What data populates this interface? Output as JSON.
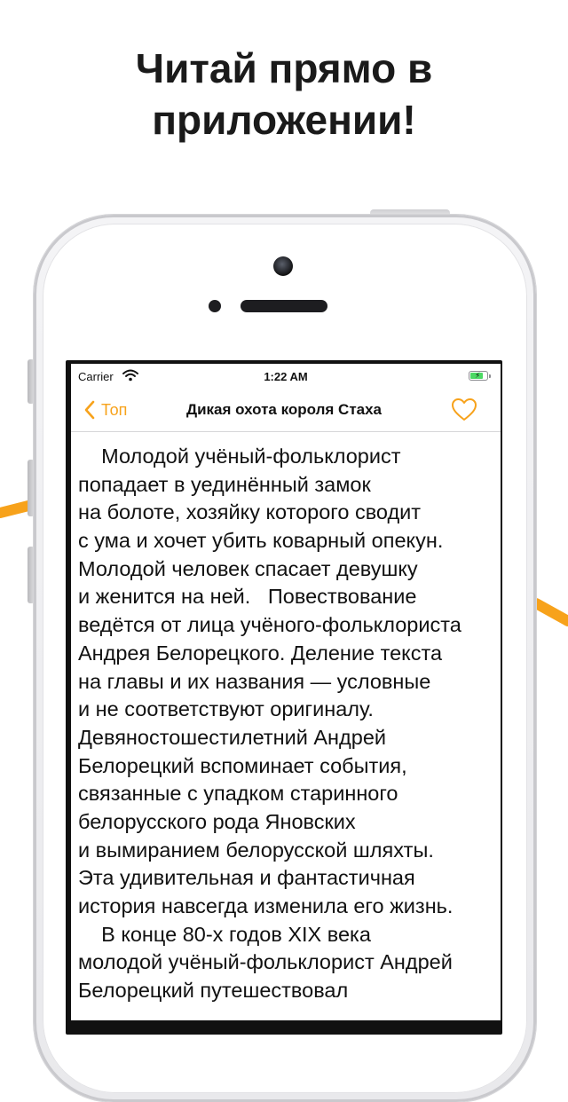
{
  "headline": {
    "line1": "Читай прямо в",
    "line2": "приложении!"
  },
  "colors": {
    "accent": "#f7a21b",
    "text": "#1a1a1a",
    "battery": "#4cd964"
  },
  "status_bar": {
    "carrier": "Carrier",
    "time": "1:22 AM",
    "battery_level": 0.8,
    "charging": true
  },
  "nav": {
    "back_label": "Топ",
    "back_icon": "chevron-left-icon",
    "title": "Дикая охота короля Стаха",
    "favorite_icon": "heart-outline-icon"
  },
  "reader": {
    "lines": [
      "    Молодой учёный-фольклорист",
      "попадает в уединённый замок",
      "на болоте, хозяйку которого сводит",
      "с ума и хочет убить коварный опекун.",
      "Молодой человек спасает девушку",
      "и женится на ней.   Повествование",
      "ведётся от лица учёного-фольклориста",
      "Андрея Белорецкого. Деление текста",
      "на главы и их названия — условные",
      "и не соответствуют оригиналу.",
      "Девяностошестилетний Андрей",
      "Белорецкий вспоминает события,",
      "связанные с упадком старинного",
      "белорусского рода Яновских",
      "и вымиранием белорусской шляхты.",
      "Эта удивительная и фантастичная",
      "история навсегда изменила его жизнь.",
      "    В конце 80-х годов XIX века",
      "молодой учёный-фольклорист Андрей",
      "Белорецкий путешествовал"
    ]
  }
}
